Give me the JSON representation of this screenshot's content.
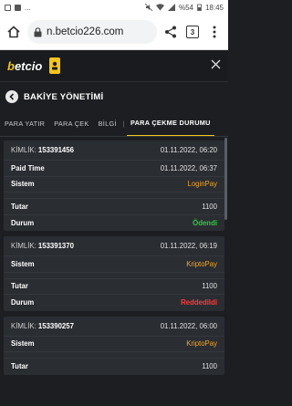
{
  "statusbar": {
    "battery": "%54",
    "time": "18:45",
    "dots": "..."
  },
  "browser": {
    "url": "n.betcio226.com",
    "tab_count": "3"
  },
  "site": {
    "logo_b": "b",
    "logo_rest": "etcio"
  },
  "page": {
    "title": "BAKİYE YÖNETİMİ"
  },
  "tabs": [
    {
      "label": "PARA YATIR"
    },
    {
      "label": "PARA ÇEK"
    },
    {
      "label": "BİLGİ"
    },
    {
      "label": "|"
    },
    {
      "label": "PARA ÇEKME DURUMU"
    }
  ],
  "records": [
    {
      "id_label": "KİMLİK:",
      "id": "153391456",
      "date": "01.11.2022, 06:20",
      "paid_label": "Paid Time",
      "paid_time": "01.11.2022, 06:37",
      "system_label": "Sistem",
      "system": "LoginPay",
      "amount_label": "Tutar",
      "amount": "1100",
      "status_label": "Durum",
      "status": "Ödendi"
    },
    {
      "id_label": "KİMLİK:",
      "id": "153391370",
      "date": "01.11.2022, 06:19",
      "system_label": "Sistem",
      "system": "KriptoPay",
      "amount_label": "Tutar",
      "amount": "1100",
      "status_label": "Durum",
      "status": "Reddedildi"
    },
    {
      "id_label": "KİMLİK:",
      "id": "153390257",
      "date": "01.11.2022, 06:00",
      "system_label": "Sistem",
      "system": "KriptoPay",
      "amount_label": "Tutar",
      "amount": "1100"
    }
  ],
  "colors": {
    "accent": "#f5c518",
    "paid": "#2ecc40",
    "rejected": "#ff3b3b",
    "system": "#f5a623"
  }
}
